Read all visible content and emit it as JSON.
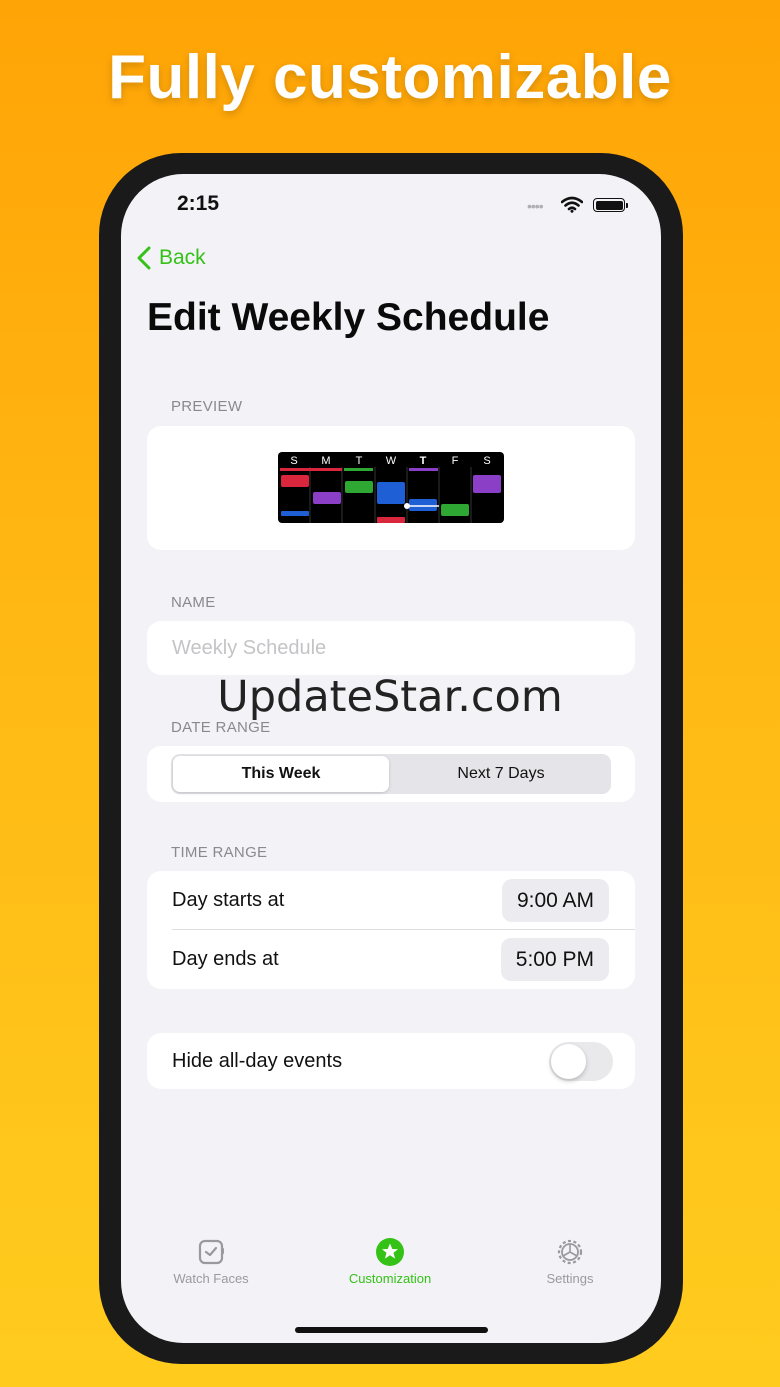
{
  "headline": "Fully customizable",
  "status_bar": {
    "time": "2:15",
    "signal_dots": "••••"
  },
  "nav": {
    "back_label": "Back"
  },
  "page_title": "Edit Weekly Schedule",
  "preview": {
    "label": "PREVIEW",
    "day_letters": [
      "S",
      "M",
      "T",
      "W",
      "T",
      "F",
      "S"
    ],
    "event_colors": {
      "red": "#d9263c",
      "purple": "#8b3fc7",
      "green": "#2fa833",
      "blue": "#1f5fd6"
    }
  },
  "name": {
    "label": "NAME",
    "placeholder": "Weekly Schedule",
    "value": ""
  },
  "date_range": {
    "label": "DATE RANGE",
    "options": [
      "This Week",
      "Next 7 Days"
    ],
    "selected": "This Week"
  },
  "time_range": {
    "label": "TIME RANGE",
    "start_label": "Day starts at",
    "start_value": "9:00 AM",
    "end_label": "Day ends at",
    "end_value": "5:00 PM"
  },
  "hide_all_day": {
    "label": "Hide all-day events",
    "enabled": false
  },
  "tabs": [
    {
      "label": "Watch Faces",
      "icon": "watch-icon",
      "active": false
    },
    {
      "label": "Customization",
      "icon": "star-circle-icon",
      "active": true
    },
    {
      "label": "Settings",
      "icon": "gear-icon",
      "active": false
    }
  ],
  "watermark": "UpdateStar.com",
  "colors": {
    "accent": "#34c217",
    "background_top": "#ffa406",
    "background_bottom": "#ffcc1e",
    "screen": "#f2f2f7"
  }
}
